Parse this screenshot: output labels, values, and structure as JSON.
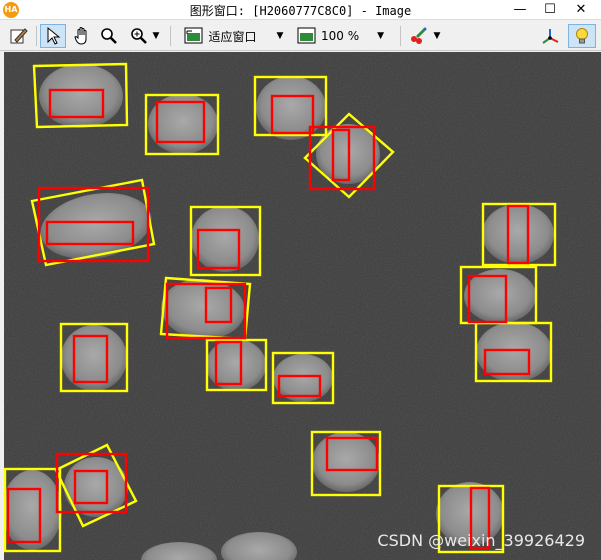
{
  "window": {
    "app_icon_text": "HA",
    "title": "图形窗口: [H2060777C8C0] - Image",
    "minimize": "—",
    "maximize": "☐",
    "close": "✕"
  },
  "toolbar": {
    "fit_window_label": "适应窗口",
    "zoom_label": "100 %",
    "dropdown_glyph": "▼"
  },
  "watermark": "CSDN @weixin_39926429",
  "colors": {
    "yellow_box": "#ffff00",
    "red_box": "#ff0000",
    "background": "#3a3a3a"
  }
}
